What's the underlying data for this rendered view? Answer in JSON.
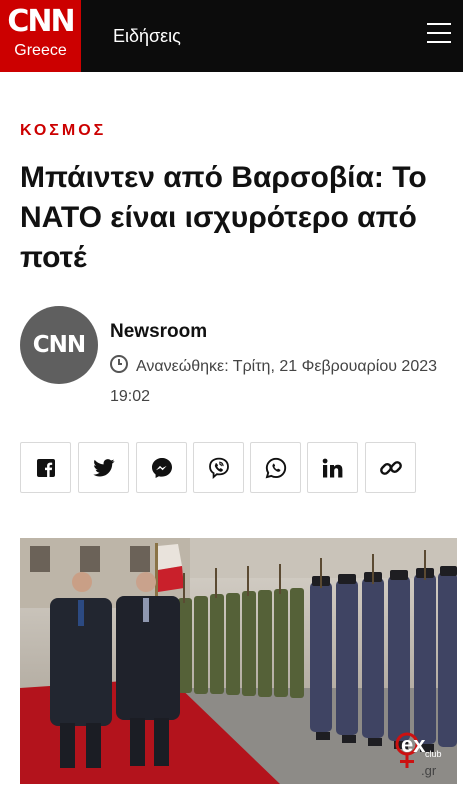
{
  "header": {
    "logo_text": "CNN",
    "logo_subtitle": "Greece",
    "title": "Ειδήσεις",
    "menu_icon": "hamburger-menu-icon"
  },
  "article": {
    "section": "ΚΟΣΜΟΣ",
    "headline": "Μπάιντεν από Βαρσοβία: Το ΝΑΤΟ είναι ισχυρότερο από ποτέ",
    "author": {
      "avatar_text": "CNN",
      "name": "Newsroom",
      "updated_label": "Ανανεώθηκε: Τρίτη, 21 Φεβρουαρίου 2023 19:02"
    }
  },
  "share_buttons": [
    {
      "icon": "facebook-icon"
    },
    {
      "icon": "twitter-icon"
    },
    {
      "icon": "messenger-icon"
    },
    {
      "icon": "viber-icon"
    },
    {
      "icon": "whatsapp-icon"
    },
    {
      "icon": "linkedin-icon"
    },
    {
      "icon": "copy-link-icon"
    }
  ],
  "photo": {
    "watermark_text": "ex",
    "watermark_sub": "club",
    "watermark_domain": ".gr"
  },
  "colors": {
    "brand_red": "#cc0000",
    "header_bg": "#0c0c0c",
    "avatar_bg": "#5f5f5f",
    "carpet_red": "#b3131c"
  }
}
